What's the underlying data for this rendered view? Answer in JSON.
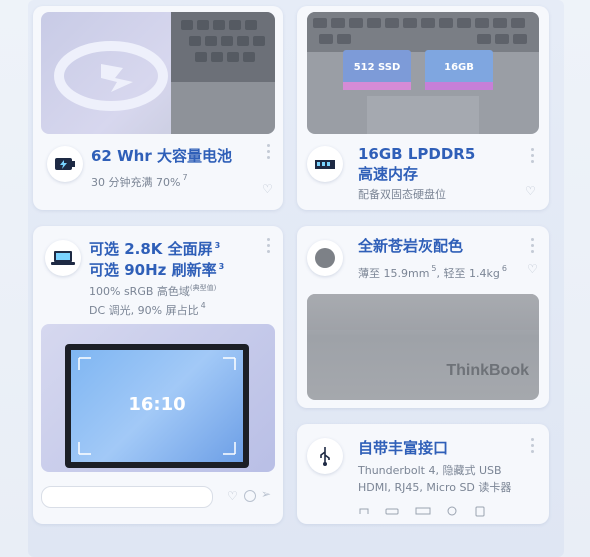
{
  "cards": {
    "battery": {
      "title": "62 Whr 大容量电池",
      "sub": "30 分钟充满 70%",
      "sub_sup": "7"
    },
    "memory": {
      "title1": "16GB LPDDR5",
      "title2": "高速内存",
      "sub": "配备双固态硬盘位",
      "chip1": "512 SSD",
      "chip2": "16GB"
    },
    "screen": {
      "title1": "可选 2.8K 全面屏",
      "title1_sup": "3",
      "title2": "可选 90Hz 刷新率",
      "title2_sup": "3",
      "sub1": "100% sRGB 高色域",
      "sub1_note": "(典型值)",
      "sub2": "DC 调光, 90% 屏占比",
      "sub2_sup": "4",
      "ratio": "16:10"
    },
    "color": {
      "title": "全新苍岩灰配色",
      "sub": "薄至 15.9mm",
      "sub_sup1": "5",
      "sub_mid": ", 轻至 1.4kg",
      "sub_sup2": "6",
      "brand": "ThinkBook"
    },
    "ports": {
      "title": "自带丰富接口",
      "sub1": "Thunderbolt 4, 隐藏式 USB",
      "sub2": "HDMI, RJ45, Micro SD 读卡器"
    }
  },
  "colors": {
    "accent": "#2f5fb8",
    "card_bg": "#f6f8fc",
    "laptop_gray": "#9a9ea5"
  },
  "icons": [
    "battery-charge-icon",
    "memory-module-icon",
    "laptop-display-icon",
    "color-swatch-icon",
    "usb-icon",
    "heart-icon",
    "kebab-menu-icon",
    "comment-icon",
    "share-icon",
    "hdmi-port-icon",
    "rj45-port-icon"
  ]
}
